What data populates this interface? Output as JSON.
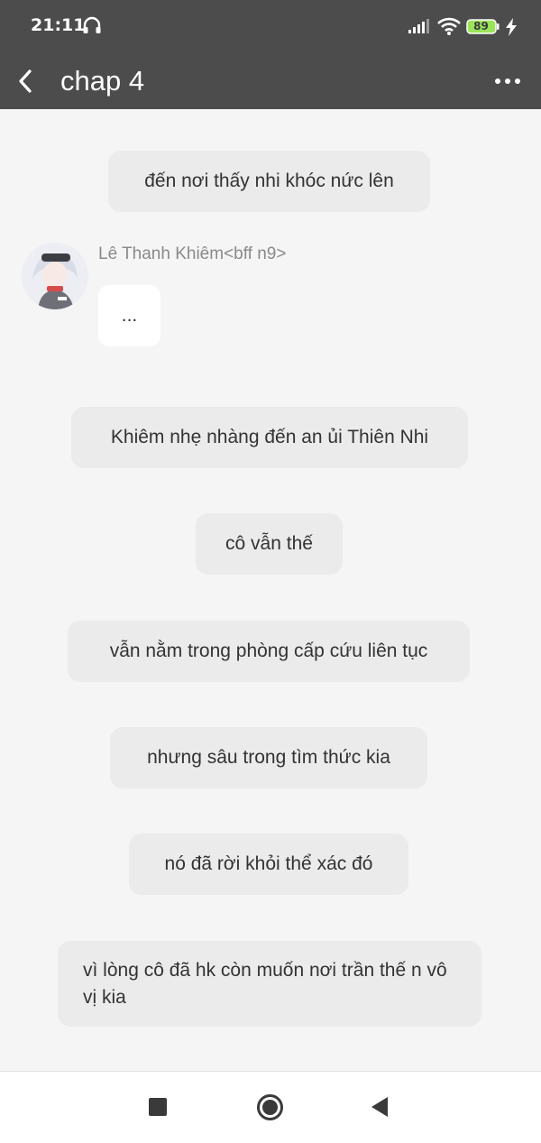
{
  "status_bar": {
    "time": "21:11",
    "battery": "89",
    "icons": [
      "headphone-icon",
      "signal-icon",
      "wifi-icon",
      "battery-icon",
      "charging-bolt-icon"
    ]
  },
  "app_bar": {
    "title": "chap 4",
    "icons": [
      "back-arrow-icon",
      "more-dots-icon"
    ]
  },
  "chat": {
    "messages": [
      {
        "type": "narration",
        "text": "đến nơi thấy nhi khóc nức lên"
      },
      {
        "type": "character",
        "speaker": "Lê Thanh Khiêm<bff n9>",
        "text": "..."
      },
      {
        "type": "narration",
        "text": "Khiêm nhẹ nhàng đến an ủi Thiên Nhi"
      },
      {
        "type": "narration",
        "text": "cô vẫn thế"
      },
      {
        "type": "narration",
        "text": "vẫn nằm trong phòng cấp cứu liên tục"
      },
      {
        "type": "narration",
        "text": "nhưng sâu trong tìm thức kia"
      },
      {
        "type": "narration",
        "text": "nó đã rời khỏi thể xác đó"
      },
      {
        "type": "narration",
        "text": "vì lòng cô đã hk còn muốn nơi trần thế n vô vị kia"
      }
    ]
  },
  "nav_bar": {
    "icons": [
      "recent-apps-icon",
      "home-icon",
      "back-icon"
    ]
  },
  "colors": {
    "header_bg": "#4c4c4c",
    "chat_bg": "#f5f5f5",
    "narration_bubble": "#ebebeb",
    "speech_bubble": "#ffffff",
    "battery_fill": "#9be45a"
  }
}
